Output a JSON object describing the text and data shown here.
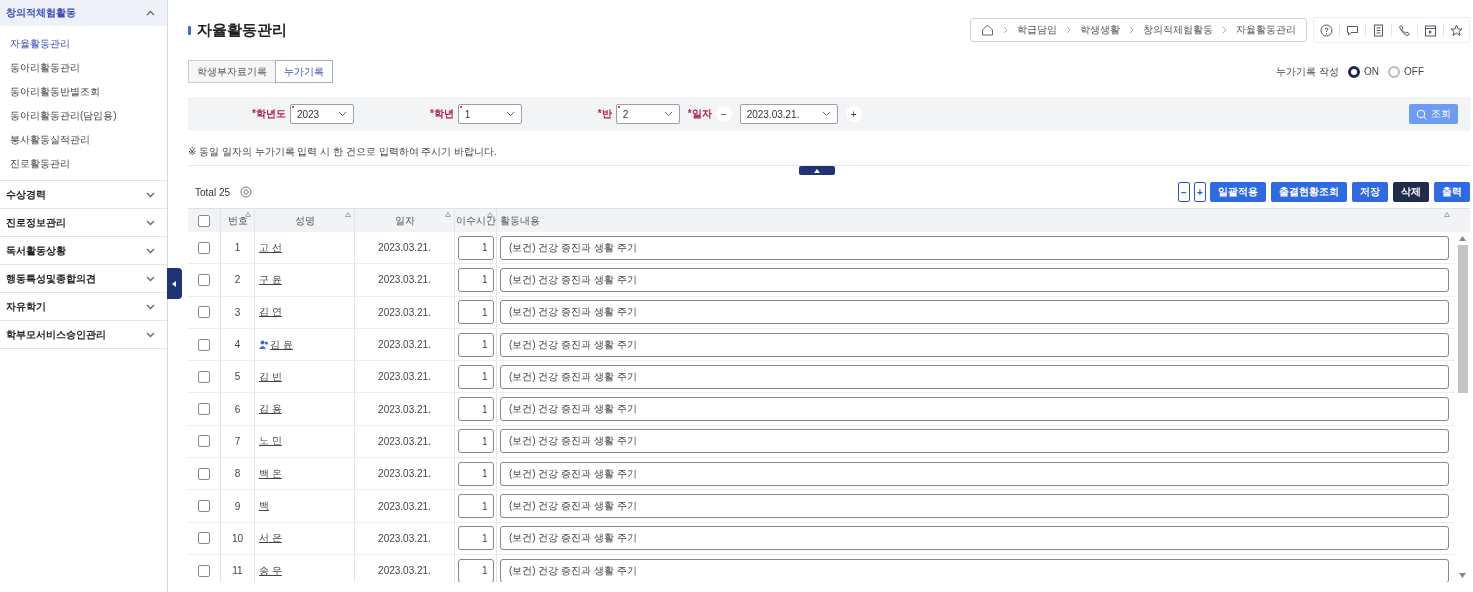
{
  "sidebar": {
    "sections": [
      {
        "label": "창의적체험활동",
        "expanded": true,
        "children": [
          {
            "label": "자율활동관리",
            "selected": true
          },
          {
            "label": "동아리활동관리",
            "selected": false
          },
          {
            "label": "동아리활동반별조회",
            "selected": false
          },
          {
            "label": "동아리활동관리(담임용)",
            "selected": false
          },
          {
            "label": "봉사활동실적관리",
            "selected": false
          },
          {
            "label": "진로활동관리",
            "selected": false
          }
        ]
      },
      {
        "label": "수상경력",
        "expanded": false
      },
      {
        "label": "진로정보관리",
        "expanded": false
      },
      {
        "label": "독서활동상황",
        "expanded": false
      },
      {
        "label": "행동특성및종합의견",
        "expanded": false
      },
      {
        "label": "자유학기",
        "expanded": false
      },
      {
        "label": "학부모서비스승인관리",
        "expanded": false
      }
    ]
  },
  "page_title": "자율활동관리",
  "breadcrumb": [
    "학급담임",
    "학생생활",
    "창의적체험활동",
    "자율활동관리"
  ],
  "tabs": [
    {
      "label": "학생부자료기록",
      "selected": false
    },
    {
      "label": "누가기록",
      "selected": true
    }
  ],
  "record_toggle": {
    "label": "누가기록 작성",
    "options": [
      {
        "label": "ON",
        "selected": true
      },
      {
        "label": "OFF",
        "selected": false
      }
    ]
  },
  "filters": [
    {
      "label": "*학년도",
      "value": "2023"
    },
    {
      "label": "*학년",
      "value": "1"
    },
    {
      "label": "*반",
      "value": "2"
    }
  ],
  "date_filter": {
    "label": "*일자",
    "minus": "−",
    "value": "2023.03.21.",
    "plus": "+"
  },
  "search_button": "조회",
  "notice": "※ 동일 일자의 누가기록 입력 시 한 건으로 입력하여 주시기 바랍니다.",
  "total": "Total 25",
  "buttons": [
    {
      "label": "−",
      "kind": "outline"
    },
    {
      "label": "+",
      "kind": "outline"
    },
    {
      "label": "일괄적용",
      "kind": "primary"
    },
    {
      "label": "출결현황조회",
      "kind": "primary"
    },
    {
      "label": "저장",
      "kind": "primary"
    },
    {
      "label": "삭제",
      "kind": "dark"
    },
    {
      "label": "출력",
      "kind": "primary"
    }
  ],
  "table": {
    "all_checked": false,
    "columns": [
      "번호",
      "성명",
      "일자",
      "이수시간",
      "활동내용"
    ],
    "rows": [
      {
        "checked": false,
        "no": "1",
        "name": "고 선",
        "person_icon": false,
        "date": "2023.03.21.",
        "hours": "1",
        "activity": "(보건) 건강 증진과 생활 주기"
      },
      {
        "checked": false,
        "no": "2",
        "name": "구 윤",
        "person_icon": false,
        "date": "2023.03.21.",
        "hours": "1",
        "activity": "(보건) 건강 증진과 생활 주기"
      },
      {
        "checked": false,
        "no": "3",
        "name": "김 연",
        "person_icon": false,
        "date": "2023.03.21.",
        "hours": "1",
        "activity": "(보건) 건강 증진과 생활 주기"
      },
      {
        "checked": false,
        "no": "4",
        "name": "김 윤",
        "person_icon": true,
        "date": "2023.03.21.",
        "hours": "1",
        "activity": "(보건) 건강 증진과 생활 주기"
      },
      {
        "checked": false,
        "no": "5",
        "name": "김 빈",
        "person_icon": false,
        "date": "2023.03.21.",
        "hours": "1",
        "activity": "(보건) 건강 증진과 생활 주기"
      },
      {
        "checked": false,
        "no": "6",
        "name": "김 용",
        "person_icon": false,
        "date": "2023.03.21.",
        "hours": "1",
        "activity": "(보건) 건강 증진과 생활 주기"
      },
      {
        "checked": false,
        "no": "7",
        "name": "노 민",
        "person_icon": false,
        "date": "2023.03.21.",
        "hours": "1",
        "activity": "(보건) 건강 증진과 생활 주기"
      },
      {
        "checked": false,
        "no": "8",
        "name": "백 온",
        "person_icon": false,
        "date": "2023.03.21.",
        "hours": "1",
        "activity": "(보건) 건강 증진과 생활 주기"
      },
      {
        "checked": false,
        "no": "9",
        "name": "백",
        "person_icon": false,
        "date": "2023.03.21.",
        "hours": "1",
        "activity": "(보건) 건강 증진과 생활 주기"
      },
      {
        "checked": false,
        "no": "10",
        "name": "서 은",
        "person_icon": false,
        "date": "2023.03.21.",
        "hours": "1",
        "activity": "(보건) 건강 증진과 생활 주기"
      },
      {
        "checked": false,
        "no": "11",
        "name": "송 우",
        "person_icon": false,
        "date": "2023.03.21.",
        "hours": "1",
        "activity": "(보건) 건강 증진과 생활 주기"
      }
    ]
  }
}
